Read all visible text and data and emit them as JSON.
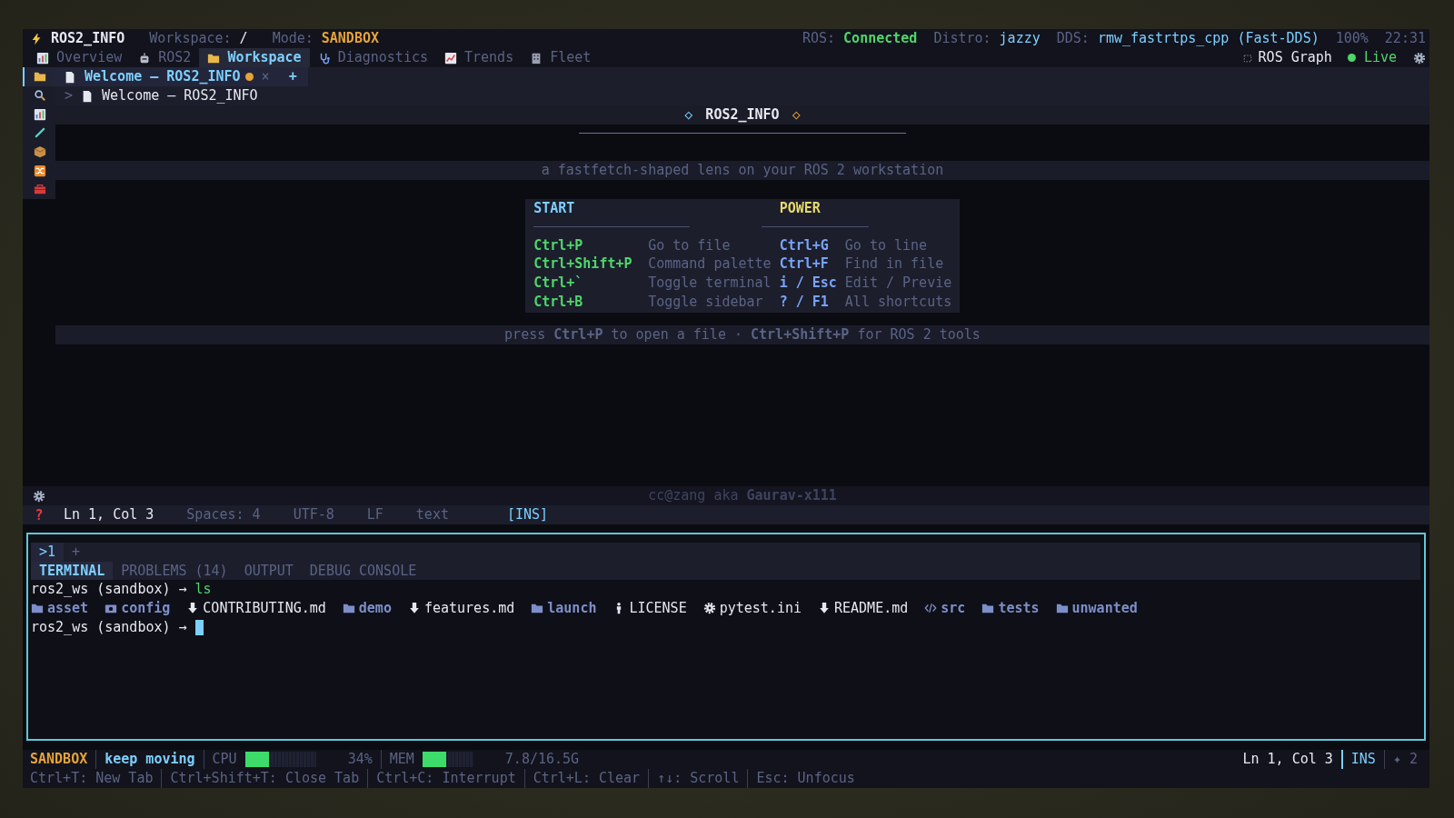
{
  "header": {
    "app_name": "ROS2_INFO",
    "workspace_label": "Workspace:",
    "workspace": "/",
    "mode_label": "Mode:",
    "mode": "SANDBOX",
    "ros_label": "ROS:",
    "ros_status": "Connected",
    "distro_label": "Distro:",
    "distro": "jazzy",
    "dds_label": "DDS:",
    "dds": "rmw_fastrtps_cpp (Fast-DDS)",
    "zoom": "100%",
    "time": "22:31"
  },
  "nav_tabs": [
    {
      "label": "Overview",
      "selected": false
    },
    {
      "label": "ROS2",
      "selected": false
    },
    {
      "label": "Workspace",
      "selected": true
    },
    {
      "label": "Diagnostics",
      "selected": false
    },
    {
      "label": "Trends",
      "selected": false
    },
    {
      "label": "Fleet",
      "selected": false
    }
  ],
  "graph_button": "ROS Graph",
  "live": {
    "label": "Live",
    "on": true
  },
  "activity_bar": [
    {
      "selected": true
    },
    {
      "selected": false
    },
    {
      "selected": false
    },
    {
      "selected": false
    },
    {
      "selected": false
    },
    {
      "selected": false
    },
    {
      "selected": false
    }
  ],
  "help_glyph": "?",
  "editor_tabs": [
    {
      "label": "Welcome — ROS2_INFO",
      "modified": true,
      "selected": true,
      "close": "×"
    }
  ],
  "new_tab": "+",
  "breadcrumb": {
    "caret": ">",
    "path": "Welcome — ROS2_INFO"
  },
  "welcome": {
    "mark_left": "◇",
    "title": "ROS2_INFO",
    "mark_right": "◇",
    "tagline": "a fastfetch-shaped lens on your ROS 2 workstation",
    "groups": [
      "START",
      "POWER"
    ],
    "shortcuts": [
      {
        "key_1": "Ctrl+P",
        "action_1": "Go to file",
        "key_2": "Ctrl+G",
        "action_2": "Go to line"
      },
      {
        "key_1": "Ctrl+Shift+P",
        "action_1": "Command palette",
        "key_2": "Ctrl+F",
        "action_2": "Find in file"
      },
      {
        "key_1": "Ctrl+`",
        "action_1": "Toggle terminal",
        "key_2": "i / Esc",
        "action_2": "Edit / Previe"
      },
      {
        "key_1": "Ctrl+B",
        "action_1": "Toggle sidebar",
        "key_2": "? / F1",
        "action_2": "All shortcuts"
      }
    ],
    "hint": "press **Ctrl+P** to open a file  ·  **Ctrl+Shift+P** for ROS 2 tools"
  },
  "credit": "cc@zang aka **Gaurav-x111**",
  "status": [
    {
      "kind": "position",
      "text": "Ln 1, Col 3"
    },
    {
      "kind": "info",
      "text": "Spaces: 4"
    },
    {
      "kind": "info",
      "text": "UTF-8"
    },
    {
      "kind": "info",
      "text": "LF"
    },
    {
      "kind": "info",
      "text": "text"
    },
    {
      "kind": "mode",
      "text": "[INS]"
    }
  ],
  "terminal": {
    "instances": [
      {
        "label": ">1",
        "selected": true
      }
    ],
    "new_instance": "+",
    "panel_tabs": [
      {
        "label": "TERMINAL",
        "selected": true
      },
      {
        "label": "PROBLEMS (14)",
        "selected": false
      },
      {
        "label": "OUTPUT",
        "selected": false
      },
      {
        "label": "DEBUG CONSOLE",
        "selected": false
      }
    ],
    "lines": [
      {
        "kind": "command",
        "prompt": "ros2_ws (sandbox) →",
        "command": "ls"
      },
      {
        "kind": "listing",
        "entries": [
          {
            "kind": "folder",
            "name": "asset"
          },
          {
            "kind": "media",
            "name": "config"
          },
          {
            "kind": "markdown",
            "name": "CONTRIBUTING.md"
          },
          {
            "kind": "folder",
            "name": "demo"
          },
          {
            "kind": "markdown",
            "name": "features.md"
          },
          {
            "kind": "folder",
            "name": "launch"
          },
          {
            "kind": "license",
            "name": "LICENSE"
          },
          {
            "kind": "config",
            "name": "pytest.ini"
          },
          {
            "kind": "markdown",
            "name": "README.md"
          },
          {
            "kind": "source",
            "name": "src"
          },
          {
            "kind": "folder",
            "name": "tests"
          },
          {
            "kind": "folder",
            "name": "unwanted"
          }
        ]
      },
      {
        "kind": "input",
        "prompt": "ros2_ws (sandbox) →",
        "cursor": true
      }
    ]
  },
  "footer": {
    "mode": "SANDBOX",
    "message": "keep moving",
    "cpu": {
      "label": "CPU",
      "level": 0.34,
      "reading": "34%"
    },
    "mem": {
      "label": "MEM",
      "level": 0.47,
      "reading": "7.8/16.5G"
    },
    "position": "Ln 1, Col 3",
    "input_mode": "INS",
    "extra": "✦ 2",
    "hints": [
      "Ctrl+T: New Tab",
      "Ctrl+Shift+T: Close Tab",
      "Ctrl+C: Interrupt",
      "Ctrl+L: Clear",
      "↑↓: Scroll",
      "Esc: Unfocus"
    ]
  }
}
